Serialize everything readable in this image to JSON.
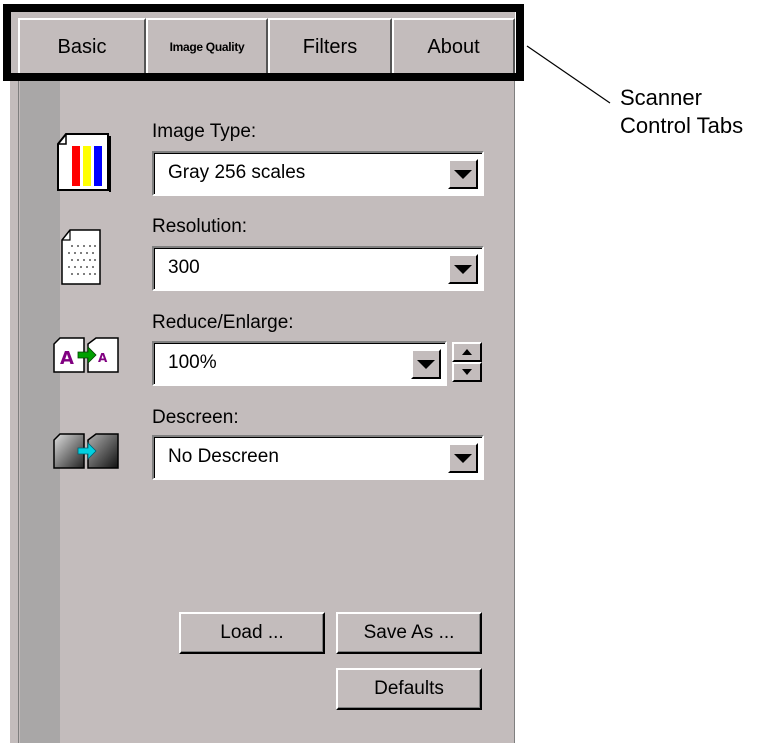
{
  "tabs": [
    {
      "label": "Basic"
    },
    {
      "label": "Image Quality"
    },
    {
      "label": "Filters"
    },
    {
      "label": "About"
    }
  ],
  "fields": {
    "image_type": {
      "label": "Image Type:",
      "value": "Gray 256 scales"
    },
    "resolution": {
      "label": "Resolution:",
      "value": "300"
    },
    "reduce_enlarge": {
      "label": "Reduce/Enlarge:",
      "value": "100%"
    },
    "descreen": {
      "label": "Descreen:",
      "value": "No Descreen"
    }
  },
  "buttons": {
    "load": "Load ...",
    "save_as": "Save As ...",
    "defaults": "Defaults"
  },
  "callout": {
    "line1": "Scanner",
    "line2": "Control Tabs"
  },
  "icons": {
    "image_type": "color-bars-document-icon",
    "resolution": "dotted-document-icon",
    "reduce_enlarge": "resize-documents-icon",
    "descreen": "descreen-documents-icon"
  },
  "colors": {
    "panel": "#c3bcbc",
    "strip": "#a9a7a7",
    "highlight": "#000000"
  }
}
